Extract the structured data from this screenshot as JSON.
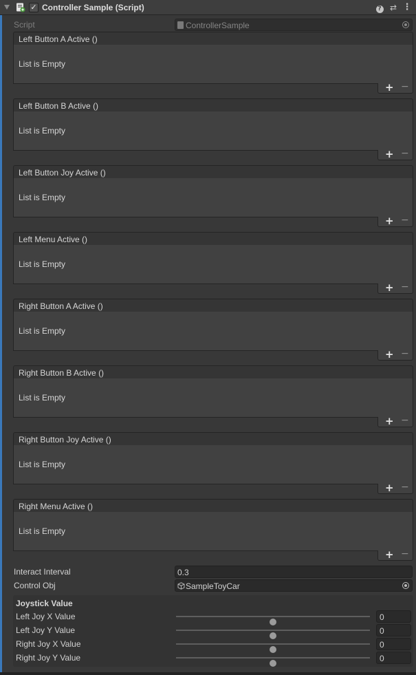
{
  "component": {
    "title": "Controller Sample (Script)",
    "enabled_mark": "✓",
    "help_glyph": "?",
    "preset_glyph": "⇄",
    "menu_glyph": "⋮"
  },
  "script_field": {
    "label": "Script",
    "value": "ControllerSample"
  },
  "events": [
    {
      "label": "Left Button A Active ()",
      "body": "List is Empty"
    },
    {
      "label": "Left Button B Active ()",
      "body": "List is Empty"
    },
    {
      "label": "Left Button Joy Active ()",
      "body": "List is Empty"
    },
    {
      "label": "Left Menu Active ()",
      "body": "List is Empty"
    },
    {
      "label": "Right Button A Active ()",
      "body": "List is Empty"
    },
    {
      "label": "Right Button B Active ()",
      "body": "List is Empty"
    },
    {
      "label": "Right Button Joy Active ()",
      "body": "List is Empty"
    },
    {
      "label": "Right Menu Active ()",
      "body": "List is Empty"
    }
  ],
  "list_buttons": {
    "add": "+",
    "remove": "−"
  },
  "interact_interval": {
    "label": "Interact Interval",
    "value": "0.3"
  },
  "control_obj": {
    "label": "Control Obj",
    "value": "SampleToyCar"
  },
  "joystick": {
    "title": "Joystick Value",
    "slider_min": -1,
    "slider_max": 1,
    "sliders": [
      {
        "label": "Left Joy X Value",
        "value": "0",
        "level": 0
      },
      {
        "label": "Left Joy Y Value",
        "value": "0",
        "level": 0
      },
      {
        "label": "Right Joy X Value",
        "value": "0",
        "level": 0
      },
      {
        "label": "Right Joy Y Value",
        "value": "0",
        "level": 0
      }
    ]
  },
  "colors": {
    "background": "#383838",
    "accent": "#3a79bb",
    "text": "#d2d2d2"
  }
}
